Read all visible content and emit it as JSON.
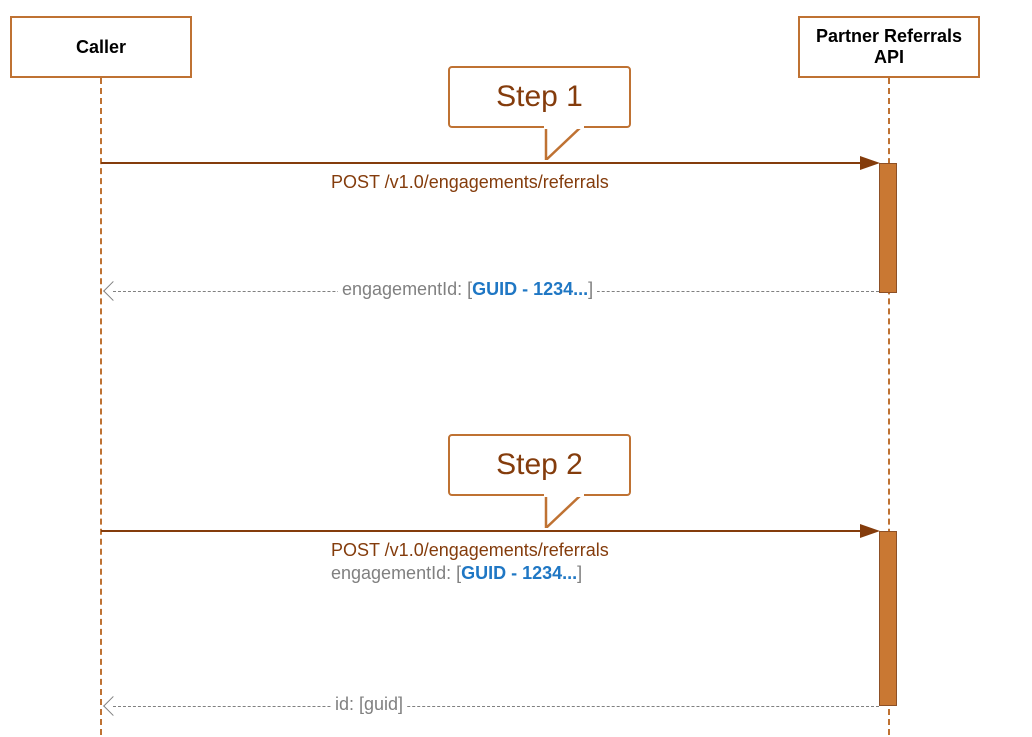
{
  "actors": {
    "caller": {
      "label": "Caller"
    },
    "api": {
      "label": "Partner Referrals API"
    }
  },
  "step1": {
    "title": "Step 1",
    "request": "POST /v1.0/engagements/referrals",
    "response_prefix": "engagementId: [",
    "response_link": "GUID - 1234...",
    "response_suffix": "]"
  },
  "step2": {
    "title": "Step 2",
    "request_line1": "POST /v1.0/engagements/referrals",
    "request_line2_prefix": "engagementId: [",
    "request_line2_link": "GUID - 1234...",
    "request_line2_suffix": "]",
    "response": "id: [guid]"
  }
}
